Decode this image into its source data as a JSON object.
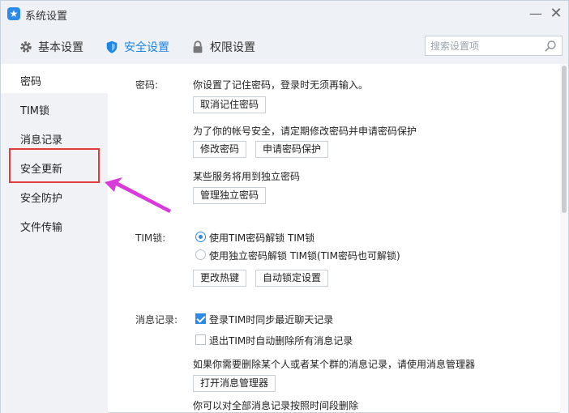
{
  "window": {
    "title": "系统设置",
    "minimize_glyph": "—",
    "close_glyph": "✕"
  },
  "topnav": {
    "tabs": [
      {
        "label": "基本设置",
        "icon": "gear-icon",
        "active": false
      },
      {
        "label": "安全设置",
        "icon": "shield-icon",
        "active": true
      },
      {
        "label": "权限设置",
        "icon": "lock-icon",
        "active": false
      }
    ],
    "search_placeholder": "搜索设置项"
  },
  "sidebar": {
    "items": [
      {
        "label": "密码"
      },
      {
        "label": "TIM锁"
      },
      {
        "label": "消息记录"
      },
      {
        "label": "安全更新"
      },
      {
        "label": "安全防护"
      },
      {
        "label": "文件传输"
      }
    ]
  },
  "password": {
    "label": "密码:",
    "remember_text": "你设置了记住密码，登录时无须再输入。",
    "cancel_remember_btn": "取消记住密码",
    "protect_text": "为了你的帐号安全，请定期修改密码并申请密码保护",
    "change_btn": "修改密码",
    "apply_protect_btn": "申请密码保护",
    "standalone_text": "某些服务将用到独立密码",
    "manage_standalone_btn": "管理独立密码"
  },
  "timlock": {
    "label": "TIM锁:",
    "option1": "使用TIM密码解锁 TIM锁",
    "option2": "使用独立密码解锁 TIM锁(TIM密码也可解锁)",
    "change_hotkey_btn": "更改热键",
    "auto_lock_btn": "自动锁定设置"
  },
  "messages": {
    "label": "消息记录:",
    "sync_text": "登录TIM时同步最近聊天记录",
    "delete_text": "退出TIM时自动删除所有消息记录",
    "manager_hint": "如果你需要删除某个人或者某个群的消息记录，请使用消息管理器",
    "open_manager_btn": "打开消息管理器",
    "delete_by_time_text": "你可以对全部消息记录按照时间段删除"
  },
  "colors": {
    "accent": "#1c86e4",
    "highlight_border": "#e23b3b",
    "arrow": "#d83bd9"
  }
}
